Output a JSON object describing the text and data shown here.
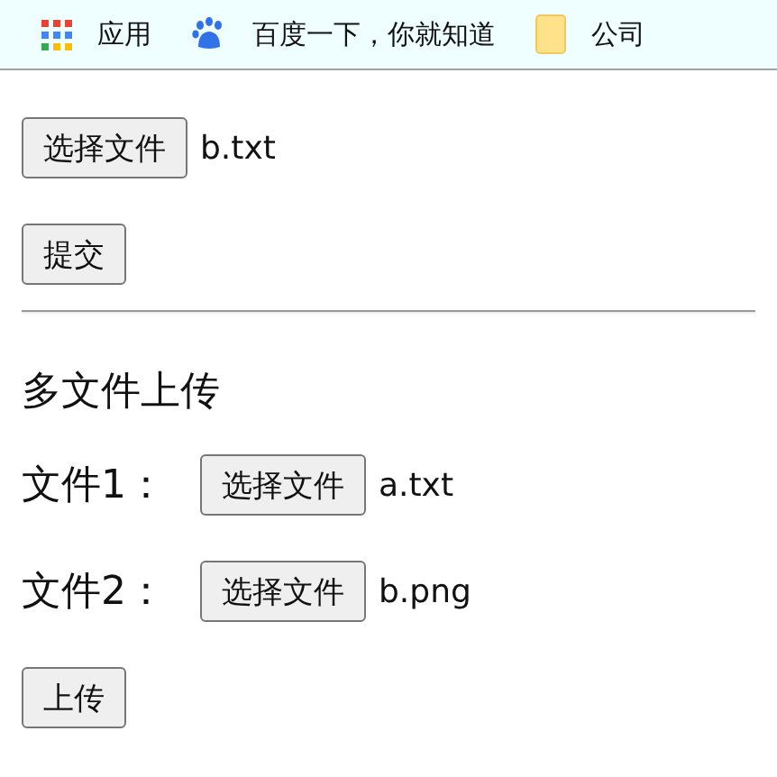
{
  "bookmarks_bar": {
    "items": [
      {
        "kind": "apps",
        "label": "应用"
      },
      {
        "kind": "paw",
        "label": "百度一下，你就知道"
      },
      {
        "kind": "folder",
        "label": "公司"
      }
    ]
  },
  "single_upload": {
    "file_input": {
      "button": "选择文件",
      "file_name": "b.txt"
    },
    "submit_button": "提交"
  },
  "multi_upload": {
    "heading": "多文件上传",
    "files": [
      {
        "label": "文件1：",
        "button": "选择文件",
        "file_name": "a.txt"
      },
      {
        "label": "文件2：",
        "button": "选择文件",
        "file_name": "b.png"
      }
    ],
    "upload_button": "上传"
  }
}
